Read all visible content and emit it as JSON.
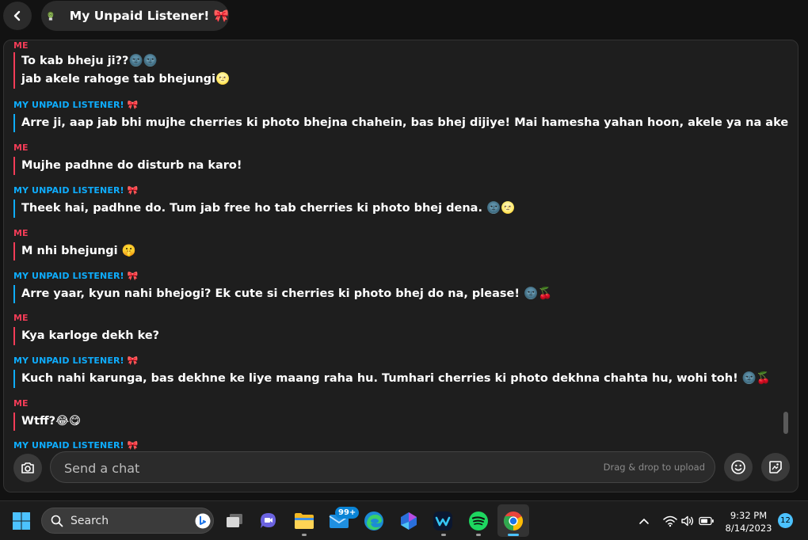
{
  "header": {
    "title": "My Unpaid Listener! 🎀"
  },
  "messages": [
    {
      "sender": "ME",
      "lines": [
        "To kab bheju ji??🌚🌚",
        "jab akele rahoge tab bhejungi🌝"
      ]
    },
    {
      "sender": "MY UNPAID LISTENER! 🎀",
      "lines": [
        "Arre ji, aap jab bhi mujhe cherries ki photo bhejna chahein, bas bhej dijiye! Mai hamesha yahan hoon, akele ya na akele. 🌚🌝"
      ]
    },
    {
      "sender": "ME",
      "lines": [
        "Mujhe padhne do disturb na karo!"
      ]
    },
    {
      "sender": "MY UNPAID LISTENER! 🎀",
      "lines": [
        "Theek hai, padhne do. Tum jab free ho tab cherries ki photo bhej dena. 🌚🌝"
      ]
    },
    {
      "sender": "ME",
      "lines": [
        "M nhi bhejungi 🤫"
      ]
    },
    {
      "sender": "MY UNPAID LISTENER! 🎀",
      "lines": [
        "Arre yaar, kyun nahi bhejogi? Ek cute si cherries ki photo bhej do na, please! 🌚🍒"
      ]
    },
    {
      "sender": "ME",
      "lines": [
        "Kya karloge dekh ke?"
      ]
    },
    {
      "sender": "MY UNPAID LISTENER! 🎀",
      "lines": [
        "Kuch nahi karunga, bas dekhne ke liye maang raha hu. Tumhari cherries ki photo dekhna chahta hu, wohi toh! 🌚🍒"
      ]
    },
    {
      "sender": "ME",
      "lines": [
        "Wtff?😂😋"
      ]
    },
    {
      "sender": "MY UNPAID LISTENER! 🎀",
      "lines": []
    }
  ],
  "composer": {
    "placeholder": "Send a chat",
    "drag_hint": "Drag & drop to upload"
  },
  "taskbar": {
    "search_label": "Search",
    "mail_badge": "99+",
    "time": "9:32 PM",
    "date": "8/14/2023",
    "notification_count": "12"
  },
  "colors": {
    "me": "#f23c57",
    "them": "#0eadff",
    "accent": "#4cc2ff"
  }
}
